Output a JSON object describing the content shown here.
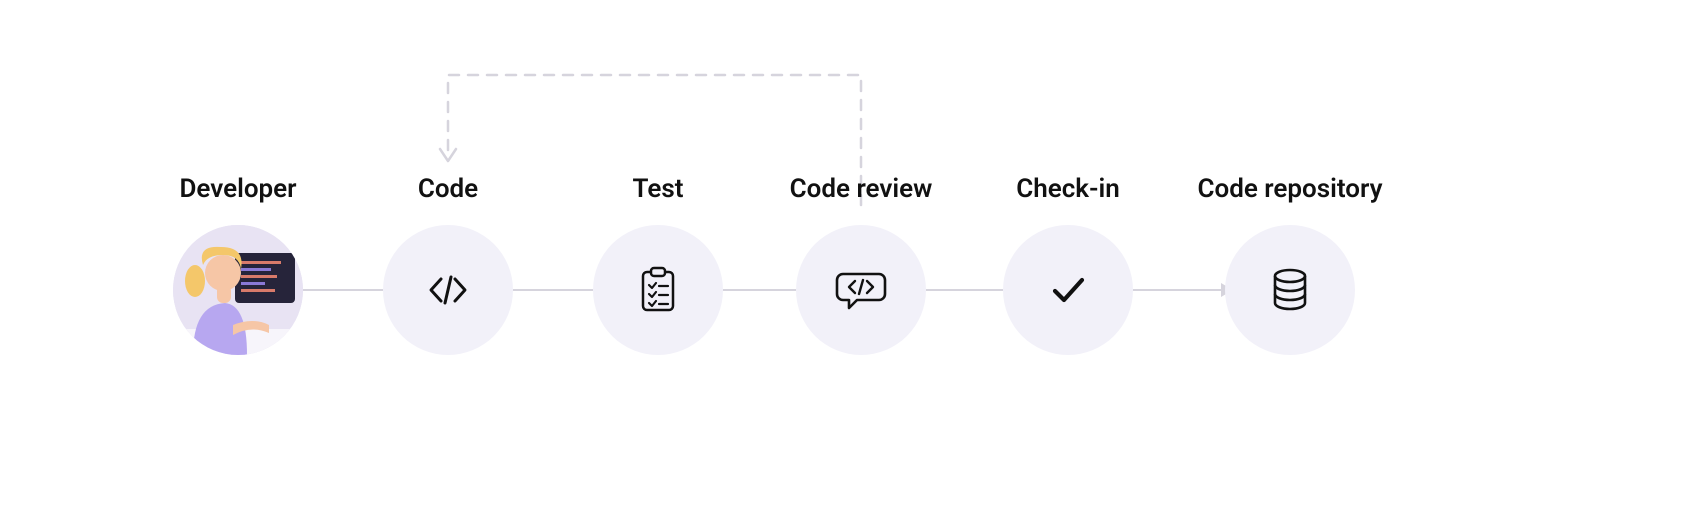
{
  "steps": [
    {
      "id": "developer",
      "label": "Developer",
      "icon": "developer-avatar"
    },
    {
      "id": "code",
      "label": "Code",
      "icon": "code-icon"
    },
    {
      "id": "test",
      "label": "Test",
      "icon": "clipboard-check-icon"
    },
    {
      "id": "review",
      "label": "Code review",
      "icon": "code-review-bubble-icon"
    },
    {
      "id": "checkin",
      "label": "Check-in",
      "icon": "checkmark-icon"
    },
    {
      "id": "repository",
      "label": "Code repository",
      "icon": "database-icon"
    }
  ],
  "feedback_loop": {
    "from": "review",
    "to": "code"
  },
  "colors": {
    "node_bg": "#f2f1f9",
    "line": "#d6d4dd",
    "text": "#111111"
  }
}
